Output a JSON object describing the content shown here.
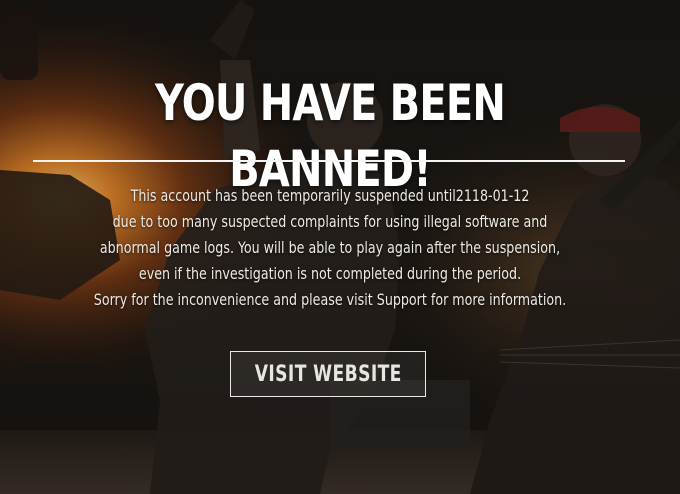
{
  "title": "YOU HAVE BEEN BANNED!",
  "message": {
    "lines": [
      "This account has been temporarily suspended until2118-01-12",
      "due to too many suspected complaints for using illegal software and",
      "abnormal game logs. You will be able to play again after the suspension,",
      "even if the investigation is not completed during the period.",
      "Sorry for the inconvenience and please visit Support for more information."
    ]
  },
  "button": {
    "label": "VISIT WEBSITE"
  }
}
